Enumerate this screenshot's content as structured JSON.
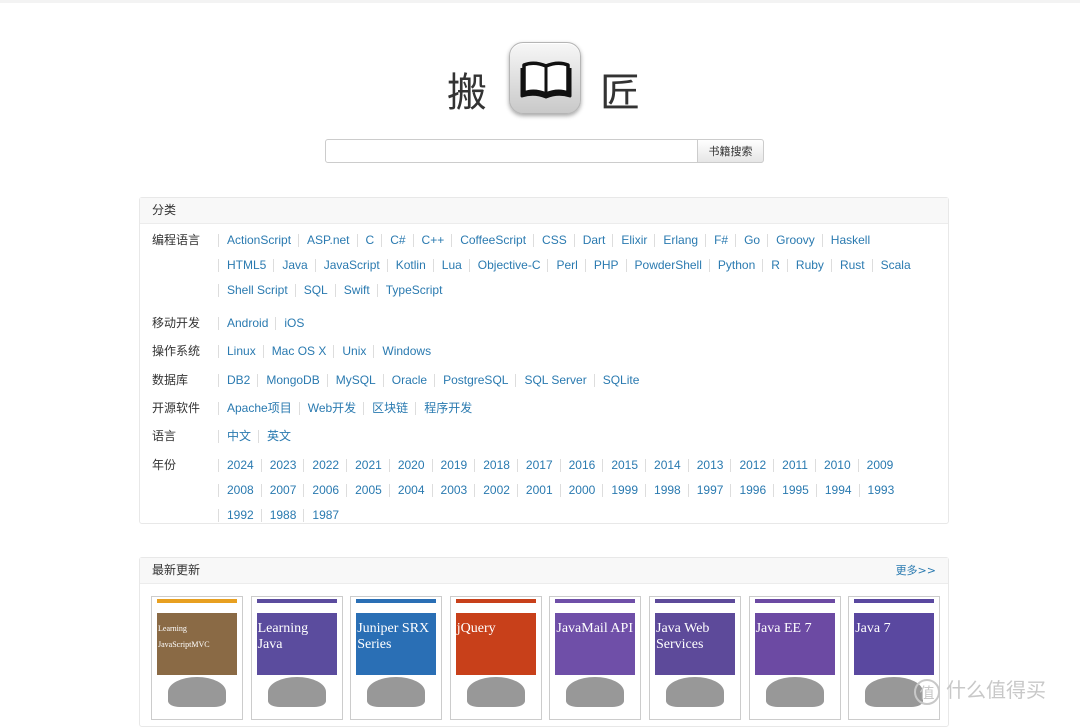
{
  "logo": {
    "left_char": "搬",
    "right_char": "匠",
    "icon": "book-icon"
  },
  "search": {
    "value": "",
    "placeholder": "",
    "button_label": "书籍搜索"
  },
  "categories": {
    "title": "分类",
    "rows": [
      {
        "label": "编程语言",
        "items": [
          "ActionScript",
          "ASP.net",
          "C",
          "C#",
          "C++",
          "CoffeeScript",
          "CSS",
          "Dart",
          "Elixir",
          "Erlang",
          "F#",
          "Go",
          "Groovy",
          "Haskell",
          "HTML5",
          "Java",
          "JavaScript",
          "Kotlin",
          "Lua",
          "Objective-C",
          "Perl",
          "PHP",
          "PowderShell",
          "Python",
          "R",
          "Ruby",
          "Rust",
          "Scala",
          "Shell Script",
          "SQL",
          "Swift",
          "TypeScript"
        ]
      },
      {
        "label": "移动开发",
        "items": [
          "Android",
          "iOS"
        ]
      },
      {
        "label": "操作系统",
        "items": [
          "Linux",
          "Mac OS X",
          "Unix",
          "Windows"
        ]
      },
      {
        "label": "数据库",
        "items": [
          "DB2",
          "MongoDB",
          "MySQL",
          "Oracle",
          "PostgreSQL",
          "SQL Server",
          "SQLite"
        ]
      },
      {
        "label": "开源软件",
        "items": [
          "Apache项目",
          "Web开发",
          "区块链",
          "程序开发"
        ]
      },
      {
        "label": "语言",
        "items": [
          "中文",
          "英文"
        ]
      },
      {
        "label": "年份",
        "items": [
          "2024",
          "2023",
          "2022",
          "2021",
          "2020",
          "2019",
          "2018",
          "2017",
          "2016",
          "2015",
          "2014",
          "2013",
          "2012",
          "2011",
          "2010",
          "2009",
          "2008",
          "2007",
          "2006",
          "2005",
          "2004",
          "2003",
          "2002",
          "2001",
          "2000",
          "1999",
          "1998",
          "1997",
          "1996",
          "1995",
          "1994",
          "1993",
          "1992",
          "1988",
          "1987"
        ]
      }
    ]
  },
  "latest": {
    "title": "最新更新",
    "more_label": "更多>>",
    "books": [
      {
        "title": "Learning JavaScriptMVC",
        "bg": "#8a6a45",
        "band": "#e8a020"
      },
      {
        "title": "Learning Java",
        "bg": "#5b4c9e",
        "band": "#5b4c9e"
      },
      {
        "title": "Juniper SRX Series",
        "bg": "#2a6fb5",
        "band": "#2a6fb5"
      },
      {
        "title": "jQuery",
        "bg": "#c8401a",
        "band": "#c8401a"
      },
      {
        "title": "JavaMail API",
        "bg": "#6f4fa8",
        "band": "#6f4fa8"
      },
      {
        "title": "Java Web Services",
        "bg": "#5d4a9a",
        "band": "#5d4a9a"
      },
      {
        "title": "Java EE 7",
        "bg": "#6c4aa3",
        "band": "#6c4aa3"
      },
      {
        "title": "Java 7",
        "bg": "#5a48a0",
        "band": "#5a48a0"
      }
    ]
  },
  "watermark": {
    "text": "什么值得买",
    "icon_text": "值"
  }
}
